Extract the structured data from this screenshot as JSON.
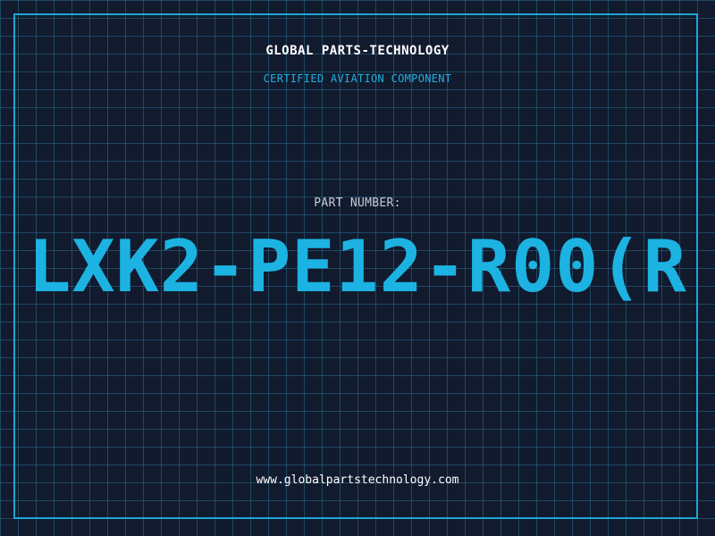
{
  "header": {
    "company": "GLOBAL PARTS-TECHNOLOGY",
    "subtitle": "CERTIFIED AVIATION COMPONENT"
  },
  "part": {
    "label": "PART NUMBER:",
    "number": "LXK2-PE12-R00(R"
  },
  "footer": {
    "url": "www.globalpartstechnology.com"
  },
  "colors": {
    "background": "#121a2e",
    "grid": "#286e8c",
    "accent": "#1cb3e2",
    "text": "#ffffff"
  }
}
